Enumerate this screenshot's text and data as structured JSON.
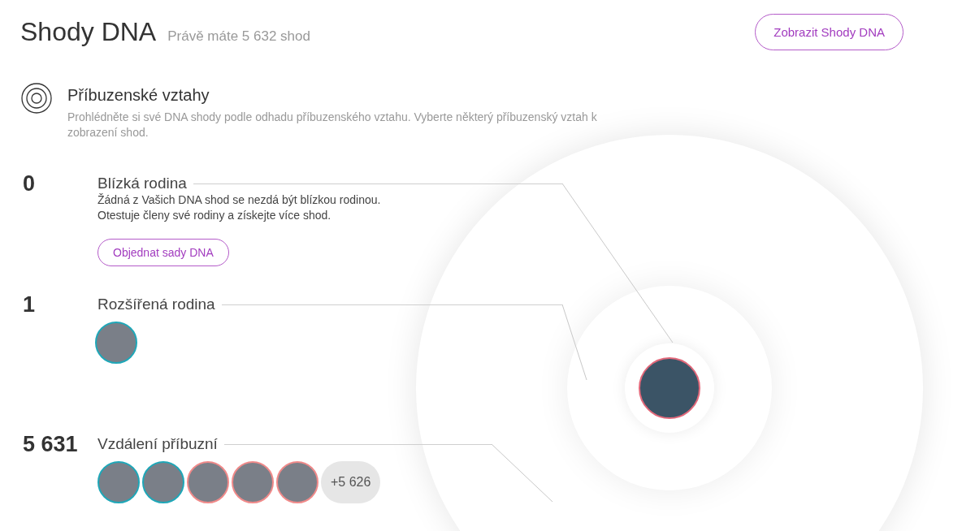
{
  "header": {
    "title": "Shody DNA",
    "subtitle": "Právě máte 5 632 shod",
    "button": "Zobrazit Shody DNA"
  },
  "section": {
    "title": "Příbuzenské vztahy",
    "description": "Prohlédněte si své DNA shody podle odhadu příbuzenského vztahu. Vyberte některý příbuzenský vztah k zobrazení shod."
  },
  "groups": [
    {
      "count": "0",
      "title": "Blízká rodina",
      "description": [
        "Žádná z Vašich DNA shod se nezdá být blízkou rodinou.",
        "Otestuje členy své rodiny a získejte více shod."
      ],
      "button": "Objednat sady DNA"
    },
    {
      "count": "1",
      "title": "Rozšířená rodina",
      "avatars": [
        {
          "color": "#1fa7b8"
        }
      ]
    },
    {
      "count": "5 631",
      "title": "Vzdálení příbuzní",
      "avatars": [
        {
          "color": "#1fa7b8"
        },
        {
          "color": "#1fa7b8"
        },
        {
          "color": "#f08a8a"
        },
        {
          "color": "#f08a8a"
        },
        {
          "color": "#f08a8a"
        }
      ],
      "more": "+5 626"
    }
  ],
  "center_photo": {
    "color": "#e2687a"
  }
}
